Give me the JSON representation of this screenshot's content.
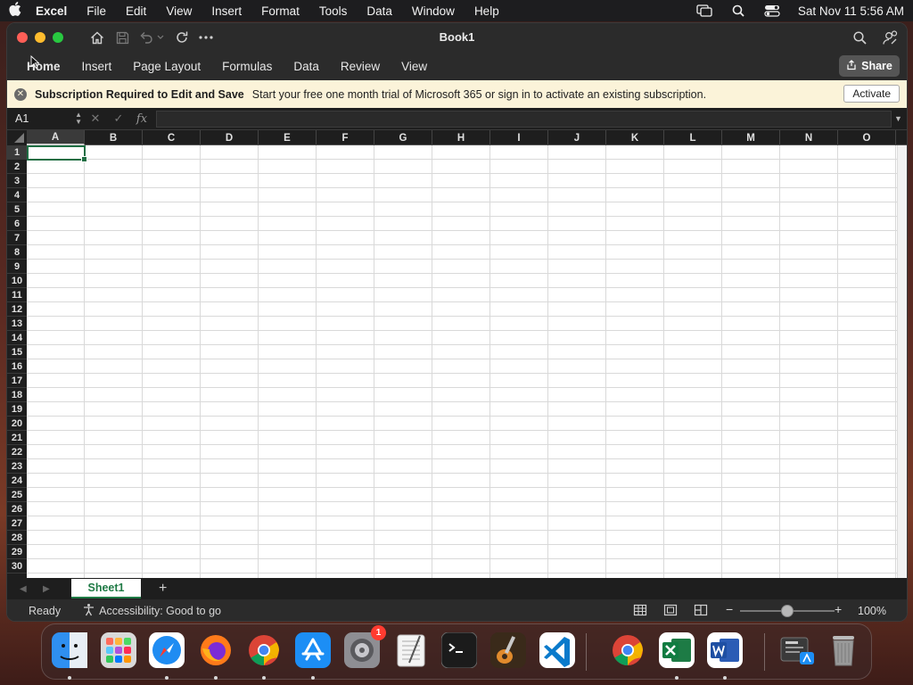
{
  "menubar": {
    "app_name": "Excel",
    "items": [
      "File",
      "Edit",
      "View",
      "Insert",
      "Format",
      "Tools",
      "Data",
      "Window",
      "Help"
    ],
    "clock": "Sat Nov 11  5:56 AM"
  },
  "window": {
    "title": "Book1"
  },
  "ribbon": {
    "tabs": [
      "Home",
      "Insert",
      "Page Layout",
      "Formulas",
      "Data",
      "Review",
      "View"
    ],
    "active_tab": "Home",
    "share_label": "Share"
  },
  "notice": {
    "title": "Subscription Required to Edit and Save",
    "message": "Start your free one month trial of Microsoft 365 or sign in to activate an existing subscription.",
    "button_label": "Activate"
  },
  "formula_bar": {
    "name_box": "A1",
    "fx_label": "fx",
    "formula_value": ""
  },
  "grid": {
    "columns": [
      "A",
      "B",
      "C",
      "D",
      "E",
      "F",
      "G",
      "H",
      "I",
      "J",
      "K",
      "L",
      "M",
      "N",
      "O"
    ],
    "rows": [
      "1",
      "2",
      "3",
      "4",
      "5",
      "6",
      "7",
      "8",
      "9",
      "10",
      "11",
      "12",
      "13",
      "14",
      "15",
      "16",
      "17",
      "18",
      "19",
      "20",
      "21",
      "22",
      "23",
      "24",
      "25",
      "26",
      "27",
      "28",
      "29",
      "30"
    ],
    "selected_cell": "A1",
    "gridline_color": "#d9d9d9",
    "selection_color": "#1f6e43"
  },
  "sheets": {
    "tabs": [
      "Sheet1"
    ],
    "active": "Sheet1",
    "accent": "#1f7a45"
  },
  "status": {
    "ready": "Ready",
    "accessibility": "Accessibility: Good to go",
    "zoom": "100%",
    "zoom_level_fraction": 0.5
  },
  "dock": {
    "items": [
      {
        "name": "finder-icon",
        "color": "#2f8ff0",
        "running": true
      },
      {
        "name": "launchpad-icon",
        "color": "#d9d9d9",
        "running": false
      },
      {
        "name": "safari-icon",
        "color": "#1f8cf2",
        "running": true
      },
      {
        "name": "firefox-icon",
        "color": "#ff7a1a",
        "running": true
      },
      {
        "name": "chrome-icon",
        "color": "#e0e0e0",
        "running": true
      },
      {
        "name": "app-store-icon",
        "color": "#1c8ef5",
        "running": true
      },
      {
        "name": "system-settings-icon",
        "color": "#8e8e93",
        "running": false,
        "badge": "1"
      },
      {
        "name": "textedit-icon",
        "color": "#f4f4f4",
        "running": false
      },
      {
        "name": "terminal-icon",
        "color": "#1b1b1b",
        "running": false
      },
      {
        "name": "garageband-icon",
        "color": "#3a2a1a",
        "running": false
      },
      {
        "name": "vscode-icon",
        "color": "#ffffff",
        "running": false
      },
      {
        "name": "chrome-icon",
        "color": "#e0e0e0",
        "running": false
      },
      {
        "name": "excel-icon",
        "color": "#1d7b45",
        "running": true
      },
      {
        "name": "word-icon",
        "color": "#2b5cb5",
        "running": true
      },
      {
        "name": "downloads-stack-icon",
        "color": "#3a3a3a",
        "running": false
      },
      {
        "name": "trash-icon",
        "color": "#9a9a9a",
        "running": false
      }
    ]
  }
}
